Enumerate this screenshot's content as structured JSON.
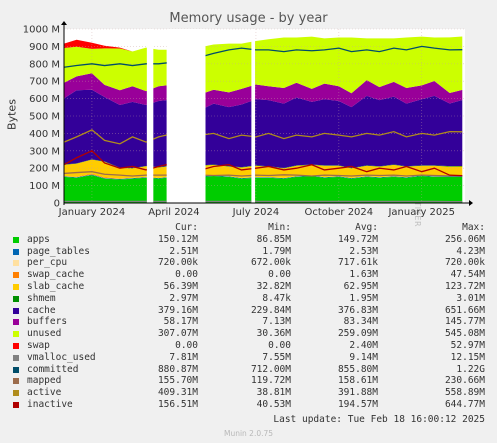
{
  "title": "Memory usage - by year",
  "watermark": "RRDTOOL / TOBI OETIKER",
  "footer": "Munin 2.0.75",
  "last_update": "Last update: Tue Feb 18 16:00:12 2025",
  "legend_headers": {
    "cur": "Cur:",
    "min": "Min:",
    "avg": "Avg:",
    "max": "Max:"
  },
  "legend": [
    {
      "name": "apps",
      "color": "#00cc00",
      "cur": "150.12M",
      "min": "86.85M",
      "avg": "149.72M",
      "max": "256.06M"
    },
    {
      "name": "page_tables",
      "color": "#0066b3",
      "cur": "2.51M",
      "min": "1.79M",
      "avg": "2.53M",
      "max": "4.23M"
    },
    {
      "name": "per_cpu",
      "color": "#ffe0a0",
      "cur": "720.00k",
      "min": "672.00k",
      "avg": "717.61k",
      "max": "720.00k"
    },
    {
      "name": "swap_cache",
      "color": "#ff8000",
      "cur": "0.00",
      "min": "0.00",
      "avg": "1.63M",
      "max": "47.54M"
    },
    {
      "name": "slab_cache",
      "color": "#ffcc00",
      "cur": "56.39M",
      "min": "32.82M",
      "avg": "62.95M",
      "max": "123.72M"
    },
    {
      "name": "shmem",
      "color": "#008f00",
      "cur": "2.97M",
      "min": "8.47k",
      "avg": "1.95M",
      "max": "3.01M"
    },
    {
      "name": "cache",
      "color": "#330099",
      "cur": "379.16M",
      "min": "229.84M",
      "avg": "376.83M",
      "max": "651.66M"
    },
    {
      "name": "buffers",
      "color": "#990099",
      "cur": "58.17M",
      "min": "7.13M",
      "avg": "83.34M",
      "max": "145.77M"
    },
    {
      "name": "unused",
      "color": "#ccff00",
      "cur": "307.07M",
      "min": "30.36M",
      "avg": "259.09M",
      "max": "545.08M"
    },
    {
      "name": "swap",
      "color": "#ff0000",
      "cur": "0.00",
      "min": "0.00",
      "avg": "2.40M",
      "max": "52.97M"
    },
    {
      "name": "vmalloc_used",
      "color": "#808080",
      "cur": "7.81M",
      "min": "7.55M",
      "avg": "9.14M",
      "max": "12.15M"
    },
    {
      "name": "committed",
      "color": "#004d69",
      "cur": "880.87M",
      "min": "712.00M",
      "avg": "855.80M",
      "max": "1.22G"
    },
    {
      "name": "mapped",
      "color": "#9c6c4c",
      "cur": "155.70M",
      "min": "119.72M",
      "avg": "158.61M",
      "max": "230.66M"
    },
    {
      "name": "active",
      "color": "#b08c1c",
      "cur": "409.31M",
      "min": "38.81M",
      "avg": "391.88M",
      "max": "558.89M"
    },
    {
      "name": "inactive",
      "color": "#b00000",
      "cur": "156.51M",
      "min": "40.53M",
      "avg": "194.57M",
      "max": "644.77M"
    }
  ],
  "chart_data": {
    "type": "area",
    "title": "Memory usage - by year",
    "ylabel": "Bytes",
    "xlabel": "",
    "y_unit": "bytes (M = 1e6)",
    "ylim": [
      0,
      1000
    ],
    "yticks": [
      "0",
      "100 M",
      "200 M",
      "300 M",
      "400 M",
      "500 M",
      "600 M",
      "700 M",
      "800 M",
      "900 M",
      "1000 M"
    ],
    "ytick_values": [
      0,
      100,
      200,
      300,
      400,
      500,
      600,
      700,
      800,
      900,
      1000
    ],
    "x_range": [
      "2023-12-01",
      "2025-02-18"
    ],
    "xticks": [
      {
        "label": "January 2024",
        "date": "2024-01-01"
      },
      {
        "label": "April 2024",
        "date": "2024-04-01"
      },
      {
        "label": "July 2024",
        "date": "2024-07-01"
      },
      {
        "label": "October 2024",
        "date": "2024-10-01"
      },
      {
        "label": "January 2025",
        "date": "2025-01-01"
      }
    ],
    "grid": true,
    "gaps": [
      [
        "2024-03-02",
        "2024-03-09"
      ],
      [
        "2024-03-24",
        "2024-05-06"
      ],
      [
        "2024-06-26",
        "2024-06-30"
      ]
    ],
    "stack_order": [
      "apps",
      "page_tables",
      "per_cpu",
      "swap_cache",
      "slab_cache",
      "shmem",
      "cache",
      "buffers",
      "unused",
      "swap"
    ],
    "line_order": [
      "vmalloc_used",
      "committed",
      "mapped",
      "active",
      "inactive"
    ],
    "x": [
      "2023-12-01",
      "2023-12-15",
      "2024-01-01",
      "2024-01-15",
      "2024-02-01",
      "2024-02-15",
      "2024-03-01",
      "2024-03-15",
      "2024-04-01",
      "2024-04-15",
      "2024-05-01",
      "2024-05-15",
      "2024-06-01",
      "2024-06-15",
      "2024-07-01",
      "2024-07-15",
      "2024-08-01",
      "2024-08-15",
      "2024-09-01",
      "2024-09-15",
      "2024-10-01",
      "2024-10-15",
      "2024-11-01",
      "2024-11-15",
      "2024-12-01",
      "2024-12-15",
      "2025-01-01",
      "2025-01-15",
      "2025-02-01",
      "2025-02-15"
    ],
    "series": [
      {
        "name": "apps",
        "values": [
          150,
          145,
          160,
          140,
          135,
          140,
          145,
          140,
          150,
          150,
          150,
          155,
          150,
          140,
          145,
          145,
          140,
          150,
          155,
          145,
          150,
          140,
          150,
          145,
          150,
          145,
          155,
          150,
          150,
          150
        ]
      },
      {
        "name": "page_tables",
        "values": [
          3,
          3,
          3,
          3,
          3,
          3,
          3,
          3,
          3,
          3,
          3,
          3,
          3,
          3,
          3,
          3,
          3,
          3,
          3,
          3,
          3,
          3,
          3,
          3,
          3,
          3,
          3,
          3,
          3,
          3
        ]
      },
      {
        "name": "per_cpu",
        "values": [
          1,
          1,
          1,
          1,
          1,
          1,
          1,
          1,
          1,
          1,
          1,
          1,
          1,
          1,
          1,
          1,
          1,
          1,
          1,
          1,
          1,
          1,
          1,
          1,
          1,
          1,
          1,
          1,
          1,
          1
        ]
      },
      {
        "name": "swap_cache",
        "values": [
          0,
          2,
          5,
          3,
          2,
          0,
          2,
          0,
          0,
          0,
          0,
          0,
          0,
          0,
          0,
          0,
          0,
          0,
          0,
          0,
          0,
          0,
          0,
          0,
          0,
          0,
          0,
          0,
          0,
          0
        ]
      },
      {
        "name": "slab_cache",
        "values": [
          65,
          75,
          80,
          90,
          60,
          55,
          60,
          60,
          60,
          60,
          60,
          60,
          55,
          60,
          65,
          60,
          55,
          60,
          60,
          65,
          60,
          55,
          60,
          60,
          65,
          60,
          55,
          60,
          55,
          56
        ]
      },
      {
        "name": "shmem",
        "values": [
          2,
          2,
          2,
          2,
          2,
          2,
          2,
          2,
          2,
          2,
          2,
          2,
          2,
          2,
          2,
          2,
          2,
          2,
          2,
          2,
          2,
          2,
          2,
          2,
          2,
          2,
          2,
          2,
          3,
          3
        ]
      },
      {
        "name": "cache",
        "values": [
          380,
          420,
          400,
          370,
          360,
          380,
          350,
          380,
          380,
          360,
          320,
          350,
          340,
          360,
          380,
          380,
          370,
          390,
          360,
          380,
          370,
          350,
          400,
          380,
          390,
          360,
          380,
          400,
          360,
          379
        ]
      },
      {
        "name": "buffers",
        "values": [
          90,
          80,
          95,
          70,
          85,
          90,
          80,
          85,
          85,
          75,
          90,
          80,
          85,
          90,
          85,
          80,
          90,
          85,
          75,
          90,
          85,
          80,
          90,
          75,
          85,
          90,
          80,
          85,
          60,
          58
        ]
      },
      {
        "name": "unused",
        "values": [
          200,
          170,
          140,
          210,
          240,
          200,
          250,
          210,
          200,
          250,
          270,
          260,
          280,
          260,
          250,
          270,
          290,
          260,
          300,
          260,
          280,
          320,
          240,
          280,
          250,
          290,
          280,
          250,
          320,
          307
        ]
      },
      {
        "name": "swap",
        "values": [
          25,
          40,
          35,
          15,
          5,
          0,
          0,
          0,
          0,
          0,
          0,
          0,
          0,
          0,
          0,
          0,
          0,
          0,
          0,
          0,
          0,
          0,
          0,
          0,
          0,
          0,
          0,
          0,
          0,
          0
        ]
      },
      {
        "name": "vmalloc_used",
        "values": [
          9,
          9,
          9,
          9,
          9,
          9,
          9,
          9,
          9,
          9,
          9,
          9,
          9,
          9,
          9,
          9,
          9,
          9,
          9,
          9,
          9,
          9,
          9,
          9,
          9,
          9,
          9,
          9,
          8,
          8
        ]
      },
      {
        "name": "committed",
        "values": [
          780,
          790,
          800,
          790,
          800,
          790,
          800,
          800,
          810,
          850,
          840,
          860,
          880,
          890,
          880,
          880,
          870,
          880,
          875,
          880,
          890,
          870,
          880,
          870,
          890,
          880,
          900,
          890,
          880,
          881
        ]
      },
      {
        "name": "mapped",
        "values": [
          170,
          175,
          180,
          165,
          160,
          155,
          160,
          160,
          160,
          155,
          160,
          158,
          160,
          155,
          160,
          158,
          162,
          160,
          155,
          160,
          158,
          155,
          160,
          158,
          160,
          155,
          160,
          158,
          156,
          156
        ]
      },
      {
        "name": "active",
        "values": [
          350,
          380,
          420,
          360,
          340,
          380,
          350,
          380,
          400,
          380,
          390,
          400,
          370,
          390,
          380,
          400,
          370,
          390,
          380,
          400,
          390,
          380,
          400,
          390,
          410,
          380,
          400,
          390,
          410,
          409
        ]
      },
      {
        "name": "inactive",
        "values": [
          220,
          260,
          300,
          230,
          200,
          210,
          190,
          210,
          230,
          200,
          190,
          210,
          220,
          190,
          200,
          210,
          190,
          200,
          220,
          190,
          200,
          210,
          180,
          200,
          190,
          210,
          180,
          200,
          160,
          157
        ]
      }
    ]
  }
}
